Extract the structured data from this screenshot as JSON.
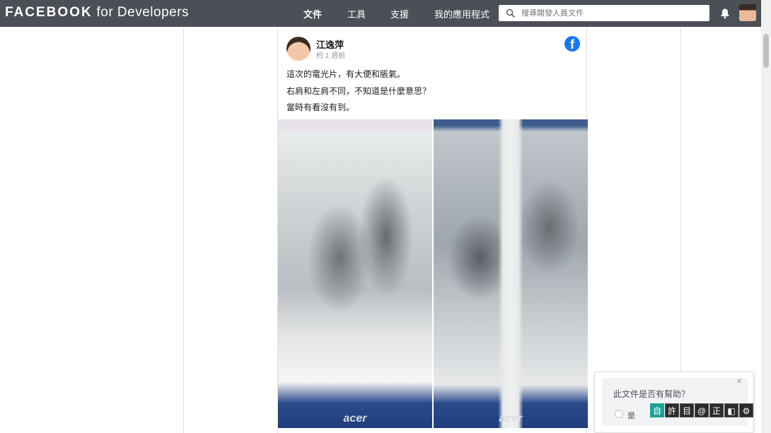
{
  "header": {
    "brand_main": "FACEBOOK",
    "brand_sub": "for Developers",
    "nav": [
      {
        "label": "文件",
        "active": true
      },
      {
        "label": "工具",
        "active": false
      },
      {
        "label": "支援",
        "active": false
      },
      {
        "label": "我的應用程式",
        "active": false
      }
    ],
    "search_placeholder": "搜尋開發人員文件",
    "icons": [
      "search-icon",
      "bell-icon",
      "profile-avatar"
    ]
  },
  "post": {
    "author": "江逸萍",
    "time": "約 1 週前",
    "lines": [
      "這次的電光片，有大便和脹氣。",
      "右肩和左肩不同，不知道是什麼意思？",
      "當時有看沒有到。"
    ],
    "images": [
      {
        "brand_text": "acer"
      },
      {
        "brand_text": "acer"
      }
    ],
    "platform_icon": "facebook-icon"
  },
  "feedback": {
    "question": "此文件是否有幫助？",
    "yes_label": "是",
    "close": "×",
    "tools": [
      "自",
      "許",
      "目",
      "@",
      "正",
      "◧",
      "⚙"
    ]
  },
  "colors": {
    "topbar": "#4b4f56",
    "facebook_blue": "#1877f2",
    "tool_teal": "#1aa39a"
  }
}
